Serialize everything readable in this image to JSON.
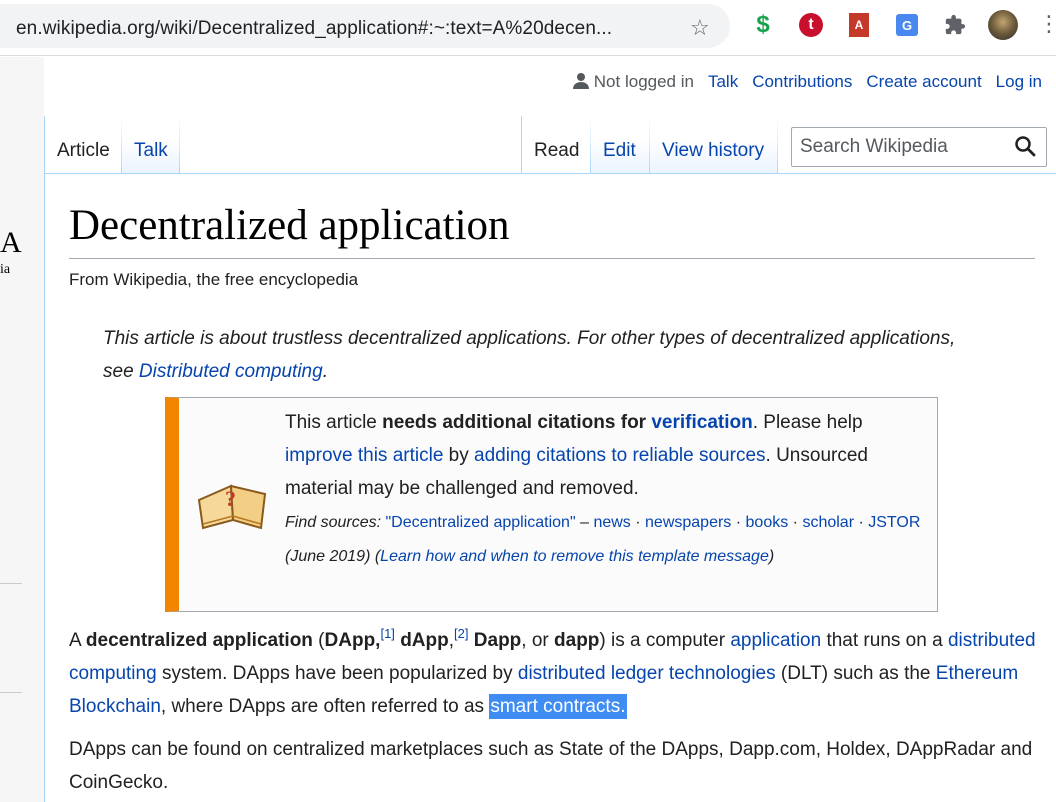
{
  "browser": {
    "url": "en.wikipedia.org/wiki/Decentralized_application#:~:text=A%20decen..."
  },
  "logo_fragment": {
    "big": "A",
    "small": "ia"
  },
  "personal": {
    "not_logged_in": "Not logged in",
    "talk": "Talk",
    "contributions": "Contributions",
    "create_account": "Create account",
    "log_in": "Log in"
  },
  "tabs": {
    "article": "Article",
    "talk": "Talk",
    "read": "Read",
    "edit": "Edit",
    "view_history": "View history"
  },
  "search": {
    "placeholder": "Search Wikipedia"
  },
  "page": {
    "title": "Decentralized application",
    "tagline": "From Wikipedia, the free encyclopedia"
  },
  "hatnote": {
    "text": "This article is about trustless decentralized applications. For other types of decentralized applications, see ",
    "link": "Distributed computing",
    "end": "."
  },
  "ambox": {
    "t1": "This article ",
    "bold1": "needs additional citations for ",
    "link_verification": "verification",
    "t2": ". Please help ",
    "link_improve": "improve this article",
    "t3": " by ",
    "link_adding": "adding citations to reliable sources",
    "t4": ". Unsourced material may be challenged and removed.",
    "find_sources": "Find sources:",
    "link_query": "\"Decentralized application\"",
    "dash": " – ",
    "link_news": "news",
    "link_newspapers": "newspapers",
    "link_books": "books",
    "link_scholar": "scholar",
    "link_jstor": "JSTOR",
    "sep": " · ",
    "date": " (June 2019) ",
    "open_paren": "(",
    "link_learn": "Learn how and when to remove this template message",
    "close_paren": ")"
  },
  "para1": {
    "a": "A ",
    "b_decentralized": "decentralized application",
    "c": " (",
    "b_dapp1": "DApp,",
    "ref1": "[1]",
    "b_dapp2": " dApp",
    "comma": ",",
    "ref2": "[2]",
    "b_dapp3": " Dapp",
    "or": ", or ",
    "b_dapp4": "dapp",
    "d": ") is a computer ",
    "link_application": "application",
    "e": " that runs on a ",
    "link_distributed": "distributed computing",
    "f": " system. DApps have been popularized by ",
    "link_dlt": "distributed ledger technologies",
    "g": " (DLT) such as the ",
    "link_ethereum": "Ethereum Blockchain",
    "h": ", where DApps are often referred to as ",
    "link_smart": "smart contracts.",
    "i": ""
  },
  "para2": {
    "text": "DApps can be found on centralized marketplaces such as State of the DApps, Dapp.com, Holdex, DAppRadar and CoinGecko."
  },
  "colors": {
    "link": "#0645ad",
    "ambox_stripe": "#f28500",
    "highlight": "#3f8cf3",
    "tab_border": "#a7d7f9"
  },
  "icons": [
    "star-icon",
    "dollar-extension-icon",
    "t-extension-icon",
    "pdf-extension-icon",
    "translate-extension-icon",
    "puzzle-extension-icon",
    "user-icon",
    "search-icon",
    "book-question-icon"
  ]
}
